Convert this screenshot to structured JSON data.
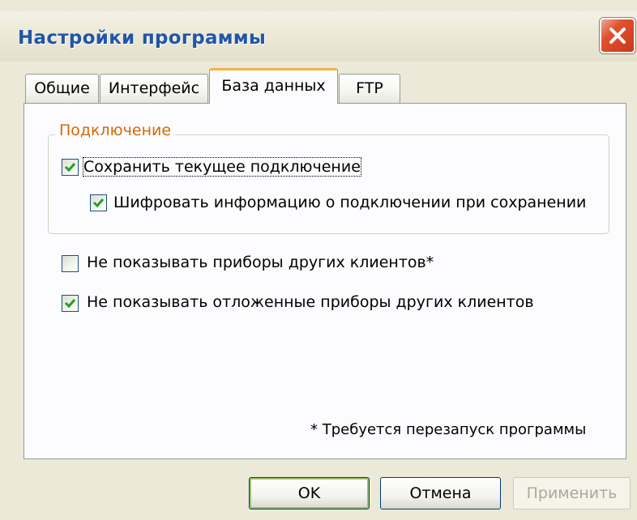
{
  "window": {
    "title": "Настройки программы"
  },
  "tabs": [
    {
      "label": "Общие",
      "active": false
    },
    {
      "label": "Интерфейс",
      "active": false
    },
    {
      "label": "База данных",
      "active": true
    },
    {
      "label": "FTP",
      "active": false
    }
  ],
  "connection_group": {
    "title": "Подключение",
    "save_connection": {
      "label": "Сохранить текущее подключение",
      "checked": true
    },
    "encrypt_connection": {
      "label": "Шифровать информацию о подключении при сохранении",
      "checked": true
    }
  },
  "options": {
    "hide_others_devices": {
      "label": "Не показывать приборы других клиентов*",
      "checked": false
    },
    "hide_postponed_devices": {
      "label": "Не показывать отложенные приборы других клиентов",
      "checked": true
    }
  },
  "note": "* Требуется перезапуск программы",
  "buttons": {
    "ok": "OK",
    "cancel": "Отмена",
    "apply": "Применить",
    "apply_enabled": false
  },
  "colors": {
    "title_text": "#2156a8",
    "close_button": "#e0522f",
    "active_tab_accent": "#f8b140",
    "group_title": "#d46a06",
    "checkmark": "#21a121"
  }
}
